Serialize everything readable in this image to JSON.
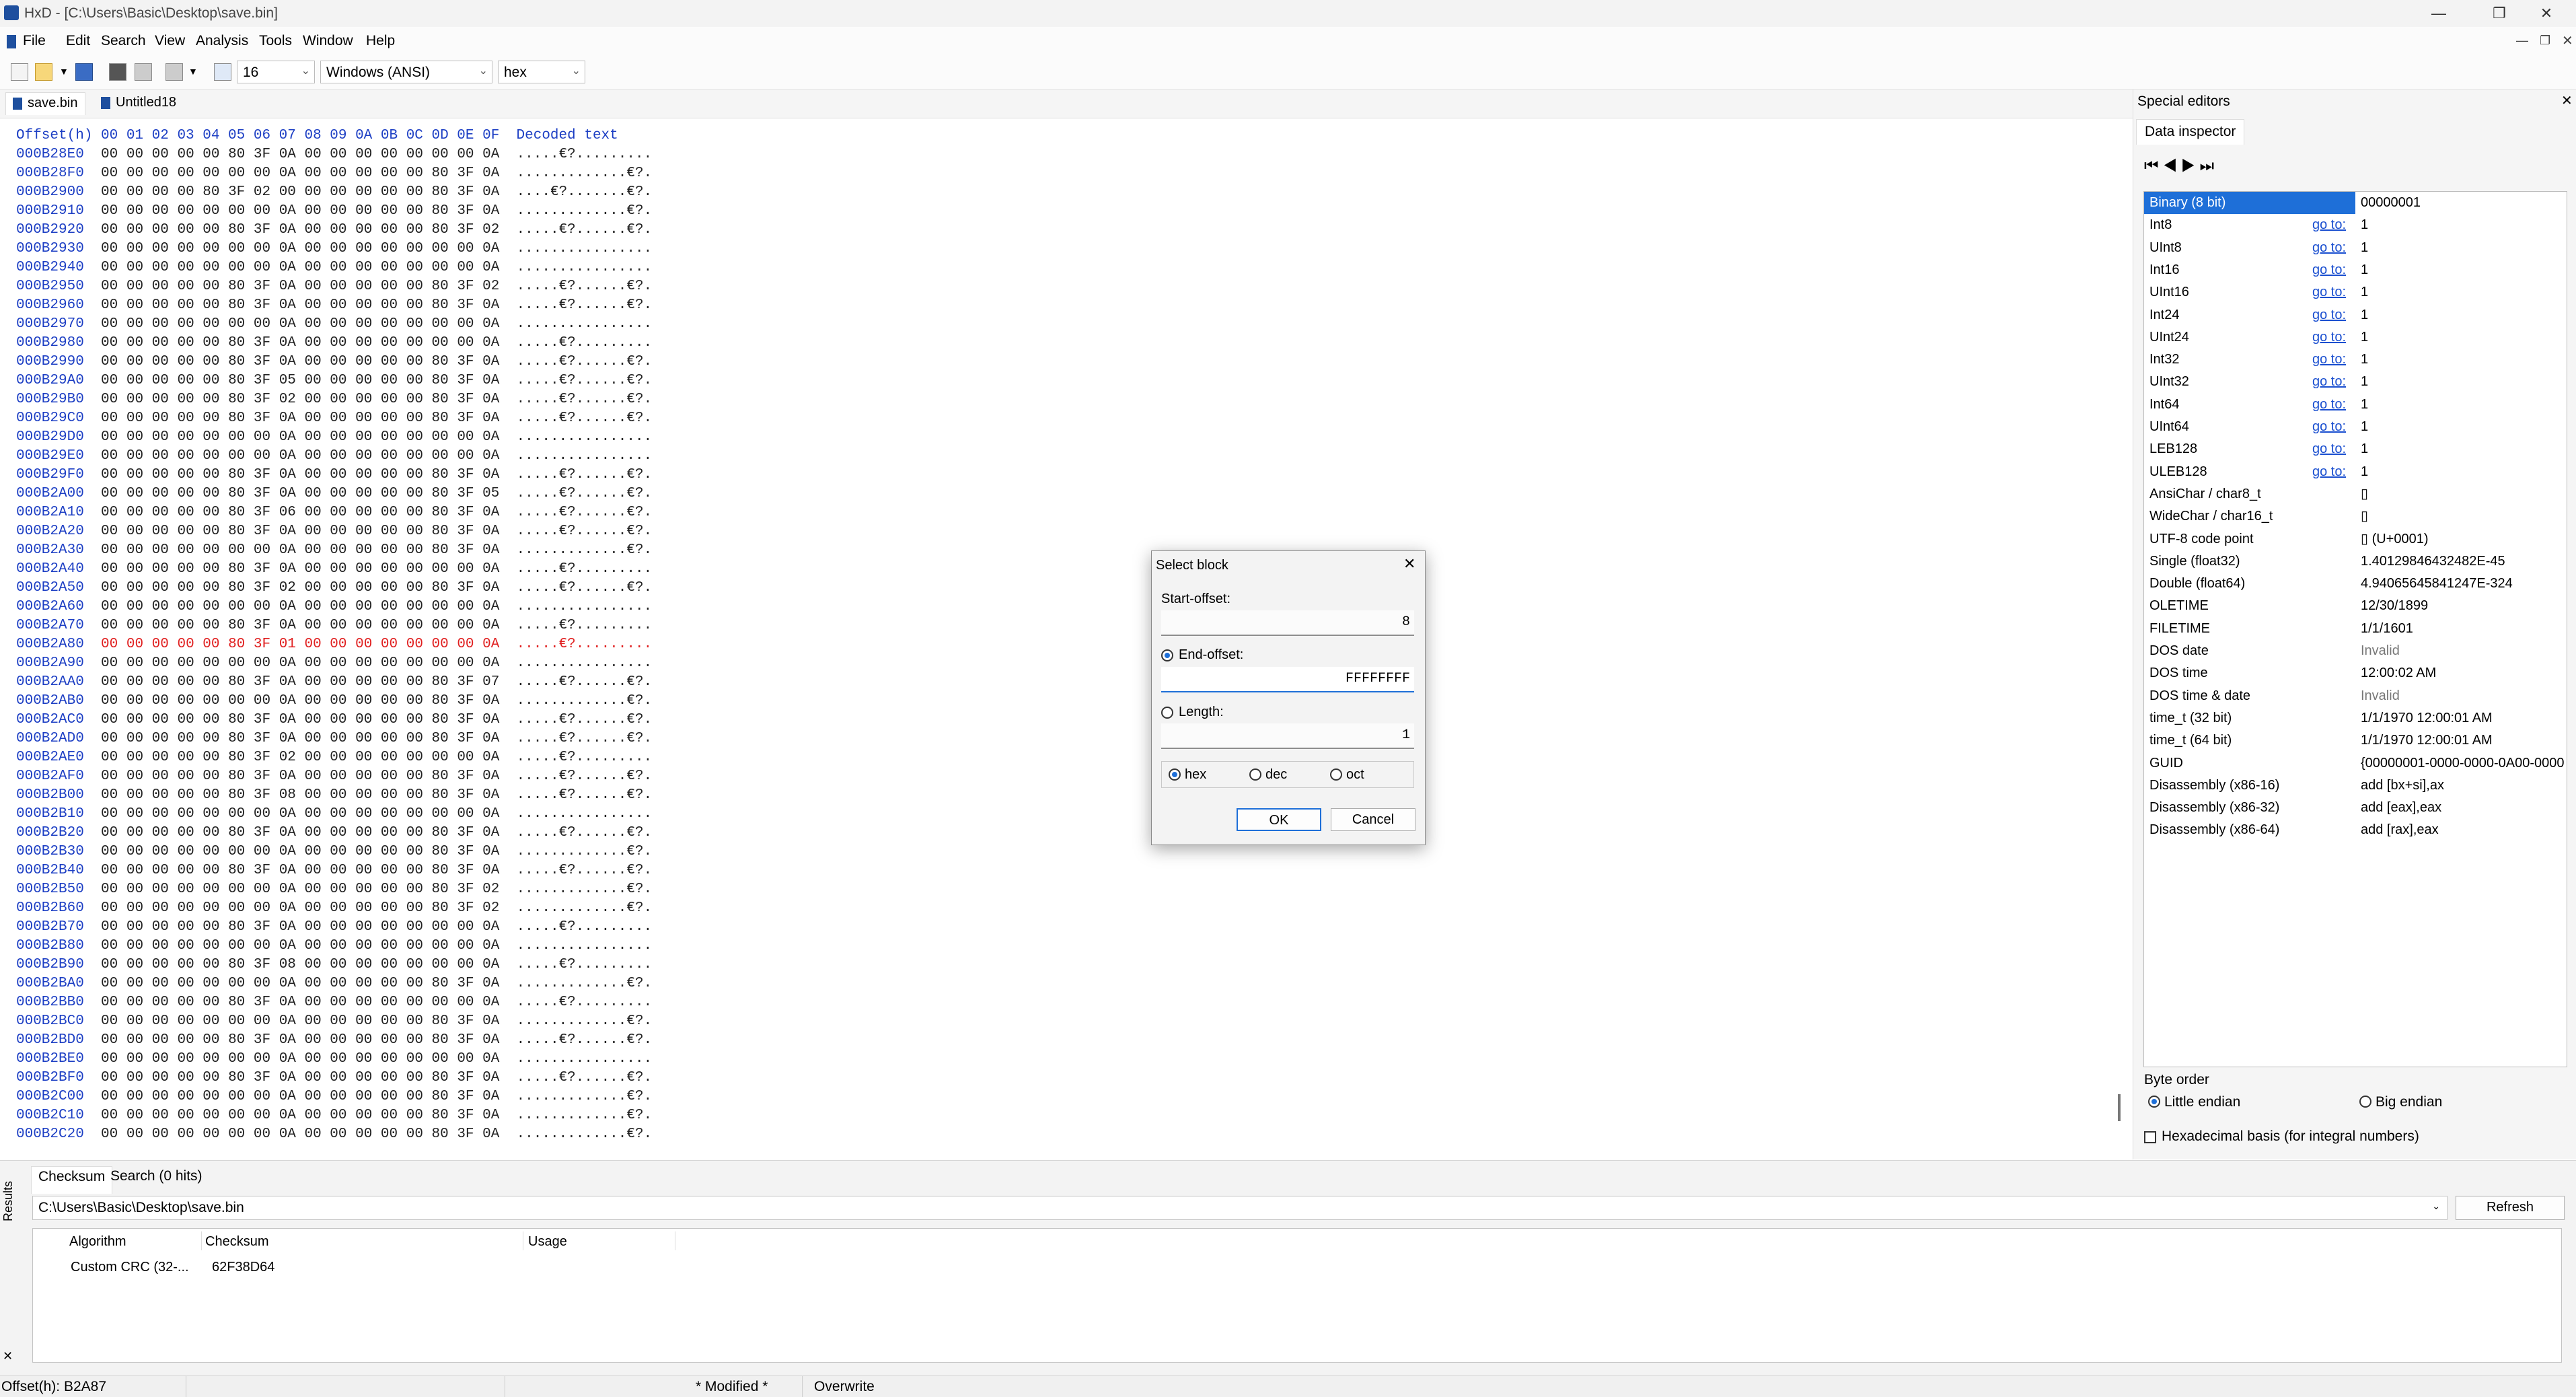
{
  "window": {
    "title": "HxD - [C:\\Users\\Basic\\Desktop\\save.bin]"
  },
  "menu": [
    "File",
    "Edit",
    "Search",
    "View",
    "Analysis",
    "Tools",
    "Window",
    "Help"
  ],
  "toolbar": {
    "bytes_per_row": "16",
    "charset": "Windows (ANSI)",
    "offset_base": "hex"
  },
  "tabs": [
    {
      "label": "save.bin"
    },
    {
      "label": "Untitled18"
    }
  ],
  "hex": {
    "header": "Offset(h) 00 01 02 03 04 05 06 07 08 09 0A 0B 0C 0D 0E 0F  Decoded text",
    "rows": [
      [
        "000B28E0",
        "00 00 00 00 00 80 3F 0A 00 00 00 00 00 00 00 0A",
        ".....€?........."
      ],
      [
        "000B28F0",
        "00 00 00 00 00 00 00 0A 00 00 00 00 00 80 3F 0A",
        ".............€?."
      ],
      [
        "000B2900",
        "00 00 00 00 80 3F 02 00 00 00 00 00 00 80 3F 0A",
        "....€?.......€?."
      ],
      [
        "000B2910",
        "00 00 00 00 00 00 00 0A 00 00 00 00 00 80 3F 0A",
        ".............€?."
      ],
      [
        "000B2920",
        "00 00 00 00 00 80 3F 0A 00 00 00 00 00 80 3F 02",
        ".....€?......€?."
      ],
      [
        "000B2930",
        "00 00 00 00 00 00 00 0A 00 00 00 00 00 00 00 0A",
        "................"
      ],
      [
        "000B2940",
        "00 00 00 00 00 00 00 0A 00 00 00 00 00 00 00 0A",
        "................"
      ],
      [
        "000B2950",
        "00 00 00 00 00 80 3F 0A 00 00 00 00 00 80 3F 02",
        ".....€?......€?."
      ],
      [
        "000B2960",
        "00 00 00 00 00 80 3F 0A 00 00 00 00 00 80 3F 0A",
        ".....€?......€?."
      ],
      [
        "000B2970",
        "00 00 00 00 00 00 00 0A 00 00 00 00 00 00 00 0A",
        "................"
      ],
      [
        "000B2980",
        "00 00 00 00 00 80 3F 0A 00 00 00 00 00 00 00 0A",
        ".....€?........."
      ],
      [
        "000B2990",
        "00 00 00 00 00 80 3F 0A 00 00 00 00 00 80 3F 0A",
        ".....€?......€?."
      ],
      [
        "000B29A0",
        "00 00 00 00 00 80 3F 05 00 00 00 00 00 80 3F 0A",
        ".....€?......€?."
      ],
      [
        "000B29B0",
        "00 00 00 00 00 80 3F 02 00 00 00 00 00 80 3F 0A",
        ".....€?......€?."
      ],
      [
        "000B29C0",
        "00 00 00 00 00 80 3F 0A 00 00 00 00 00 80 3F 0A",
        ".....€?......€?."
      ],
      [
        "000B29D0",
        "00 00 00 00 00 00 00 0A 00 00 00 00 00 00 00 0A",
        "................"
      ],
      [
        "000B29E0",
        "00 00 00 00 00 00 00 0A 00 00 00 00 00 00 00 0A",
        "................"
      ],
      [
        "000B29F0",
        "00 00 00 00 00 80 3F 0A 00 00 00 00 00 80 3F 0A",
        ".....€?......€?."
      ],
      [
        "000B2A00",
        "00 00 00 00 00 80 3F 0A 00 00 00 00 00 80 3F 05",
        ".....€?......€?."
      ],
      [
        "000B2A10",
        "00 00 00 00 00 80 3F 06 00 00 00 00 00 80 3F 0A",
        ".....€?......€?."
      ],
      [
        "000B2A20",
        "00 00 00 00 00 80 3F 0A 00 00 00 00 00 80 3F 0A",
        ".....€?......€?."
      ],
      [
        "000B2A30",
        "00 00 00 00 00 00 00 0A 00 00 00 00 00 80 3F 0A",
        ".............€?."
      ],
      [
        "000B2A40",
        "00 00 00 00 00 80 3F 0A 00 00 00 00 00 00 00 0A",
        ".....€?........."
      ],
      [
        "000B2A50",
        "00 00 00 00 00 80 3F 02 00 00 00 00 00 80 3F 0A",
        ".....€?......€?."
      ],
      [
        "000B2A60",
        "00 00 00 00 00 00 00 0A 00 00 00 00 00 00 00 0A",
        "................"
      ],
      [
        "000B2A70",
        "00 00 00 00 00 80 3F 0A 00 00 00 00 00 00 00 0A",
        ".....€?........."
      ],
      [
        "000B2A80",
        "00 00 00 00 00 80 3F 01 00 00 00 00 00 00 00 0A",
        ".....€?........."
      ],
      [
        "000B2A90",
        "00 00 00 00 00 00 00 0A 00 00 00 00 00 00 00 0A",
        "................"
      ],
      [
        "000B2AA0",
        "00 00 00 00 00 80 3F 0A 00 00 00 00 00 80 3F 07",
        ".....€?......€?."
      ],
      [
        "000B2AB0",
        "00 00 00 00 00 00 00 0A 00 00 00 00 00 80 3F 0A",
        ".............€?."
      ],
      [
        "000B2AC0",
        "00 00 00 00 00 80 3F 0A 00 00 00 00 00 80 3F 0A",
        ".....€?......€?."
      ],
      [
        "000B2AD0",
        "00 00 00 00 00 80 3F 0A 00 00 00 00 00 80 3F 0A",
        ".....€?......€?."
      ],
      [
        "000B2AE0",
        "00 00 00 00 00 80 3F 02 00 00 00 00 00 00 00 0A",
        ".....€?........."
      ],
      [
        "000B2AF0",
        "00 00 00 00 00 80 3F 0A 00 00 00 00 00 80 3F 0A",
        ".....€?......€?."
      ],
      [
        "000B2B00",
        "00 00 00 00 00 80 3F 08 00 00 00 00 00 80 3F 0A",
        ".....€?......€?."
      ],
      [
        "000B2B10",
        "00 00 00 00 00 00 00 0A 00 00 00 00 00 00 00 0A",
        "................"
      ],
      [
        "000B2B20",
        "00 00 00 00 00 80 3F 0A 00 00 00 00 00 80 3F 0A",
        ".....€?......€?."
      ],
      [
        "000B2B30",
        "00 00 00 00 00 00 00 0A 00 00 00 00 00 80 3F 0A",
        ".............€?."
      ],
      [
        "000B2B40",
        "00 00 00 00 00 80 3F 0A 00 00 00 00 00 80 3F 0A",
        ".....€?......€?."
      ],
      [
        "000B2B50",
        "00 00 00 00 00 00 00 0A 00 00 00 00 00 80 3F 02",
        ".............€?."
      ],
      [
        "000B2B60",
        "00 00 00 00 00 00 00 0A 00 00 00 00 00 80 3F 02",
        ".............€?."
      ],
      [
        "000B2B70",
        "00 00 00 00 00 80 3F 0A 00 00 00 00 00 00 00 0A",
        ".....€?........."
      ],
      [
        "000B2B80",
        "00 00 00 00 00 00 00 0A 00 00 00 00 00 00 00 0A",
        "................"
      ],
      [
        "000B2B90",
        "00 00 00 00 00 80 3F 08 00 00 00 00 00 00 00 0A",
        ".....€?........."
      ],
      [
        "000B2BA0",
        "00 00 00 00 00 00 00 0A 00 00 00 00 00 80 3F 0A",
        ".............€?."
      ],
      [
        "000B2BB0",
        "00 00 00 00 00 80 3F 0A 00 00 00 00 00 00 00 0A",
        ".....€?........."
      ],
      [
        "000B2BC0",
        "00 00 00 00 00 00 00 0A 00 00 00 00 00 80 3F 0A",
        ".............€?."
      ],
      [
        "000B2BD0",
        "00 00 00 00 00 80 3F 0A 00 00 00 00 00 80 3F 0A",
        ".....€?......€?."
      ],
      [
        "000B2BE0",
        "00 00 00 00 00 00 00 0A 00 00 00 00 00 00 00 0A",
        "................"
      ],
      [
        "000B2BF0",
        "00 00 00 00 00 80 3F 0A 00 00 00 00 00 80 3F 0A",
        ".....€?......€?."
      ],
      [
        "000B2C00",
        "00 00 00 00 00 00 00 0A 00 00 00 00 00 80 3F 0A",
        ".............€?."
      ],
      [
        "000B2C10",
        "00 00 00 00 00 00 00 0A 00 00 00 00 00 80 3F 0A",
        ".............€?."
      ],
      [
        "000B2C20",
        "00 00 00 00 00 00 00 0A 00 00 00 00 00 80 3F 0A",
        ".............€?."
      ]
    ],
    "selected_offset": "000B2A80",
    "selected_bytes": "80 3F 01",
    "selected_text": "€?."
  },
  "special_editors": {
    "title": "Special editors",
    "tab": "Data inspector",
    "rows": [
      {
        "name": "Binary (8 bit)",
        "goto": "",
        "value": "00000001"
      },
      {
        "name": "Int8",
        "goto": "go to:",
        "value": "1"
      },
      {
        "name": "UInt8",
        "goto": "go to:",
        "value": "1"
      },
      {
        "name": "Int16",
        "goto": "go to:",
        "value": "1"
      },
      {
        "name": "UInt16",
        "goto": "go to:",
        "value": "1"
      },
      {
        "name": "Int24",
        "goto": "go to:",
        "value": "1"
      },
      {
        "name": "UInt24",
        "goto": "go to:",
        "value": "1"
      },
      {
        "name": "Int32",
        "goto": "go to:",
        "value": "1"
      },
      {
        "name": "UInt32",
        "goto": "go to:",
        "value": "1"
      },
      {
        "name": "Int64",
        "goto": "go to:",
        "value": "1"
      },
      {
        "name": "UInt64",
        "goto": "go to:",
        "value": "1"
      },
      {
        "name": "LEB128",
        "goto": "go to:",
        "value": "1"
      },
      {
        "name": "ULEB128",
        "goto": "go to:",
        "value": "1"
      },
      {
        "name": "AnsiChar / char8_t",
        "goto": "",
        "value": "▯"
      },
      {
        "name": "WideChar / char16_t",
        "goto": "",
        "value": "▯"
      },
      {
        "name": "UTF-8 code point",
        "goto": "",
        "value": "▯ (U+0001)"
      },
      {
        "name": "Single (float32)",
        "goto": "",
        "value": "1.40129846432482E-45"
      },
      {
        "name": "Double (float64)",
        "goto": "",
        "value": "4.94065645841247E-324"
      },
      {
        "name": "OLETIME",
        "goto": "",
        "value": "12/30/1899"
      },
      {
        "name": "FILETIME",
        "goto": "",
        "value": "1/1/1601"
      },
      {
        "name": "DOS date",
        "goto": "",
        "value": "Invalid"
      },
      {
        "name": "DOS time",
        "goto": "",
        "value": "12:00:02 AM"
      },
      {
        "name": "DOS time & date",
        "goto": "",
        "value": "Invalid"
      },
      {
        "name": "time_t (32 bit)",
        "goto": "",
        "value": "1/1/1970 12:00:01 AM"
      },
      {
        "name": "time_t (64 bit)",
        "goto": "",
        "value": "1/1/1970 12:00:01 AM"
      },
      {
        "name": "GUID",
        "goto": "",
        "value": "{00000001-0000-0000-0A00-0000"
      },
      {
        "name": "Disassembly (x86-16)",
        "goto": "",
        "value": "add [bx+si],ax"
      },
      {
        "name": "Disassembly (x86-32)",
        "goto": "",
        "value": "add [eax],eax"
      },
      {
        "name": "Disassembly (x86-64)",
        "goto": "",
        "value": "add [rax],eax"
      }
    ],
    "byte_order_label": "Byte order",
    "little_endian": "Little endian",
    "big_endian": "Big endian",
    "hex_basis": "Hexadecimal basis (for integral numbers)"
  },
  "dialog": {
    "title": "Select block",
    "start_label": "Start-offset:",
    "start_value": "8",
    "end_label": "End-offset:",
    "end_value": "FFFFFFFF",
    "length_label": "Length:",
    "length_value": "1",
    "bases": [
      "hex",
      "dec",
      "oct"
    ],
    "ok": "OK",
    "cancel": "Cancel"
  },
  "results": {
    "side_label": "Results",
    "tabs": [
      "Checksum",
      "Search (0 hits)"
    ],
    "path": "C:\\Users\\Basic\\Desktop\\save.bin",
    "refresh": "Refresh",
    "columns": [
      "Algorithm",
      "Checksum",
      "Usage"
    ],
    "rows": [
      [
        "Custom CRC (32-...",
        "62F38D64",
        ""
      ]
    ]
  },
  "status": {
    "offset": "Offset(h): B2A87",
    "modified": "* Modified *",
    "mode": "Overwrite"
  },
  "colors": {
    "offset_blue": "#1d3fc4",
    "selection_blue": "#1e6fd8",
    "changed_red": "#e02020",
    "link_blue": "#1a4fd0"
  }
}
